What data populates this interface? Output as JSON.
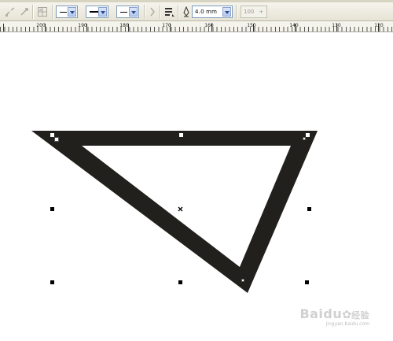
{
  "toolbar": {
    "icons": [
      "connector-icon",
      "dimension-icon",
      "grid-icon",
      "wrap-icon",
      "outline-pen-icon"
    ],
    "line_start_style": "arrow-none",
    "line_style": "solid",
    "line_end_style": "arrow-none",
    "outline_width": "4.0 mm",
    "zoom_value": "100"
  },
  "ruler": {
    "labels": [
      "200",
      "190",
      "180",
      "170",
      "160",
      "150",
      "140",
      "130",
      "120"
    ]
  },
  "colors": {
    "shape_fill": "#22201d",
    "handle": "#000000",
    "toolbar_bg": "#ece9d8"
  },
  "watermark": {
    "brand": "Baidu",
    "brand_suffix": "经验",
    "url": "jingyan.baidu.com"
  }
}
